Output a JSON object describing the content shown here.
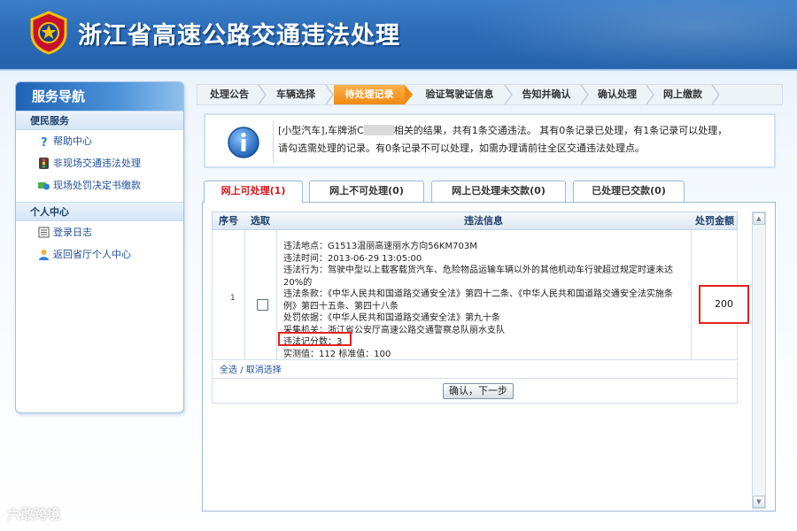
{
  "header": {
    "title": "浙江省高速公路交通违法处理"
  },
  "sidebar": {
    "title": "服务导航",
    "sections": [
      {
        "label": "便民服务",
        "items": [
          {
            "label": "帮助中心",
            "icon": "help-icon"
          },
          {
            "label": "非现场交通违法处理",
            "icon": "traffic-light-icon"
          },
          {
            "label": "现场处罚决定书缴款",
            "icon": "payment-icon"
          }
        ]
      },
      {
        "label": "个人中心",
        "items": [
          {
            "label": "登录日志",
            "icon": "log-icon"
          },
          {
            "label": "返回省厅个人中心",
            "icon": "user-icon"
          }
        ]
      }
    ]
  },
  "steps": [
    {
      "label": "处理公告",
      "active": false
    },
    {
      "label": "车辆选择",
      "active": false
    },
    {
      "label": "待处理记录",
      "active": true
    },
    {
      "label": "验证驾驶证信息",
      "active": false
    },
    {
      "label": "告知并确认",
      "active": false
    },
    {
      "label": "确认处理",
      "active": false
    },
    {
      "label": "网上缴款",
      "active": false
    }
  ],
  "info": {
    "line1_prefix": "[小型汽车],车牌浙C",
    "line1_suffix": "相关的结果，共有1条交通违法。 其有0条记录已处理，有1条记录可以处理，",
    "line2": "请勾选需处理的记录。有0条记录不可以处理，如需办理请前往全区交通违法处理点。"
  },
  "tabs": [
    {
      "label": "网上可处理(1)",
      "active": true
    },
    {
      "label": "网上不可处理(0)",
      "active": false
    },
    {
      "label": "网上已处理未交款(0)",
      "active": false
    },
    {
      "label": "已处理已交款(0)",
      "active": false
    }
  ],
  "table": {
    "headers": {
      "seq": "序号",
      "select": "选取",
      "info": "违法信息",
      "amount": "处罚金额"
    },
    "rows": [
      {
        "seq": "1",
        "lines": [
          "违法地点：G1513温丽高速丽水方向56KM703M",
          "违法时间：2013-06-29 13:05:00",
          "违法行为：驾驶中型以上载客载货汽车、危险物品运输车辆以外的其他机动车行驶超过规定时速未达20%的",
          "违法条款：《中华人民共和国道路交通安全法》第四十二条、《中华人民共和国道路交通安全法实施条例》第四十五条、第四十八条",
          "处罚依据：《中华人民共和国道路交通安全法》第九十条",
          "采集机关：浙江省公安厅高速公路交通警察总队丽水支队",
          "违法记分数：3",
          "实测值：112    标准值：100"
        ],
        "amount": "200"
      }
    ],
    "select_all": "全选",
    "select_sep": "/",
    "deselect": "取消选择",
    "confirm_button": "确认，下一步"
  },
  "watermark": "六敢跨境",
  "colors": {
    "header_blue": "#2c6cb8",
    "active_step": "#f08a12",
    "active_tab_text": "#d8141a",
    "highlight_red": "#e3211c",
    "link_blue": "#1f4f9a"
  }
}
